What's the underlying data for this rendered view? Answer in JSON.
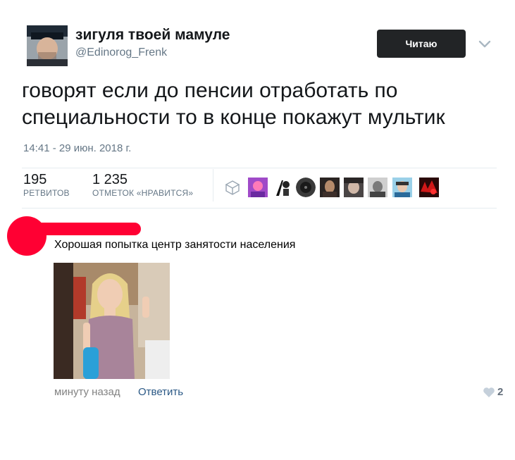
{
  "tweet": {
    "display_name": "зигуля твоей мамуле",
    "handle": "@Edinorog_Frenk",
    "follow_label": "Читаю",
    "text": "говорят если до пенсии отработать по специальности то в конце покажут мультик",
    "timestamp": "14:41 - 29 июн. 2018 г.",
    "retweets_count": "195",
    "retweets_label": "РЕТВИТОВ",
    "likes_count": "1 235",
    "likes_label": "ОТМЕТОК «НРАВИТСЯ»",
    "liked_by_avatar_count": 8
  },
  "comment": {
    "text": "Хорошая попытка центр занятости населения",
    "time": "минуту назад",
    "reply_label": "Ответить",
    "likes": "2"
  },
  "icons": {
    "menu": "chevron-down-icon",
    "badge": "box-icon",
    "like": "heart-icon"
  },
  "colors": {
    "follow_button_bg": "#222426",
    "link": "#2a5885",
    "redaction": "#ff0033",
    "muted_text": "#657786"
  }
}
